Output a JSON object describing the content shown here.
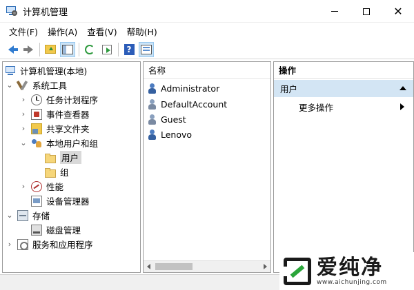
{
  "window": {
    "title": "计算机管理",
    "controls": {
      "close_glyph": "✕"
    }
  },
  "menu": [
    "文件(F)",
    "操作(A)",
    "查看(V)",
    "帮助(H)"
  ],
  "toolbar": {
    "icons": [
      "back-arrow-icon",
      "forward-arrow-icon",
      "up-folder-icon",
      "show-hide-tree-icon",
      "refresh-icon",
      "export-list-icon",
      "help-icon",
      "properties-icon"
    ],
    "help_glyph": "?"
  },
  "tree": {
    "root": {
      "label": "计算机管理(本地)"
    },
    "system_tools": {
      "label": "系统工具",
      "expanded": true
    },
    "task_scheduler": {
      "label": "任务计划程序"
    },
    "event_viewer": {
      "label": "事件查看器"
    },
    "shared_folders": {
      "label": "共享文件夹"
    },
    "local_users_groups": {
      "label": "本地用户和组",
      "expanded": true
    },
    "users": {
      "label": "用户",
      "selected": true
    },
    "groups": {
      "label": "组"
    },
    "performance": {
      "label": "性能"
    },
    "device_manager": {
      "label": "设备管理器"
    },
    "storage": {
      "label": "存储",
      "expanded": true
    },
    "disk_management": {
      "label": "磁盘管理"
    },
    "services_apps": {
      "label": "服务和应用程序"
    },
    "glyphs": {
      "expanded": "⌄",
      "collapsed": "›"
    }
  },
  "list": {
    "column_name": "名称",
    "users": [
      {
        "name": "Administrator",
        "disabled": false
      },
      {
        "name": "DefaultAccount",
        "disabled": true
      },
      {
        "name": "Guest",
        "disabled": true
      },
      {
        "name": "Lenovo",
        "disabled": false
      }
    ]
  },
  "actions": {
    "header": "操作",
    "section": "用户",
    "more_actions": "更多操作"
  },
  "watermark": {
    "title": "爱纯净",
    "url": "www.aichunjing.com"
  },
  "colors": {
    "selection_bg": "#d9d9d9",
    "action_section_bg": "#d3e5f4",
    "accent_blue": "#2f7bd0"
  }
}
